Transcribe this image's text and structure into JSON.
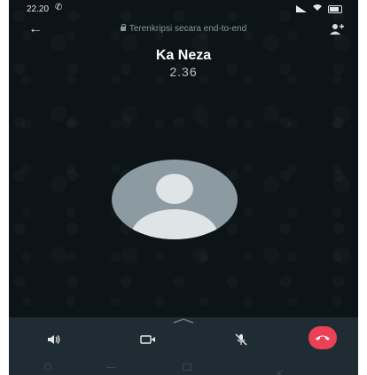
{
  "status_bar": {
    "time": "22.20",
    "call_indicator": "phone-icon",
    "right_icons": [
      "signal-icon",
      "wifi-icon",
      "battery-icon"
    ]
  },
  "top_bar": {
    "back_icon": "arrow-left-icon",
    "encryption_text": "Terenkripsi secara end-to-end",
    "add_participant_icon": "add-person-icon"
  },
  "call": {
    "contact_name": "Ka Neza",
    "duration": "2.36"
  },
  "controls": {
    "speaker_icon": "speaker-icon",
    "video_icon": "video-camera-icon",
    "mute_icon": "microphone-off-icon",
    "end_call_icon": "end-call-icon"
  },
  "colors": {
    "background": "#0d1418",
    "control_bar": "#1f2c33",
    "end_call": "#ea4155",
    "avatar_bg": "#8c9ba2",
    "avatar_fg": "#dfe4e6"
  }
}
